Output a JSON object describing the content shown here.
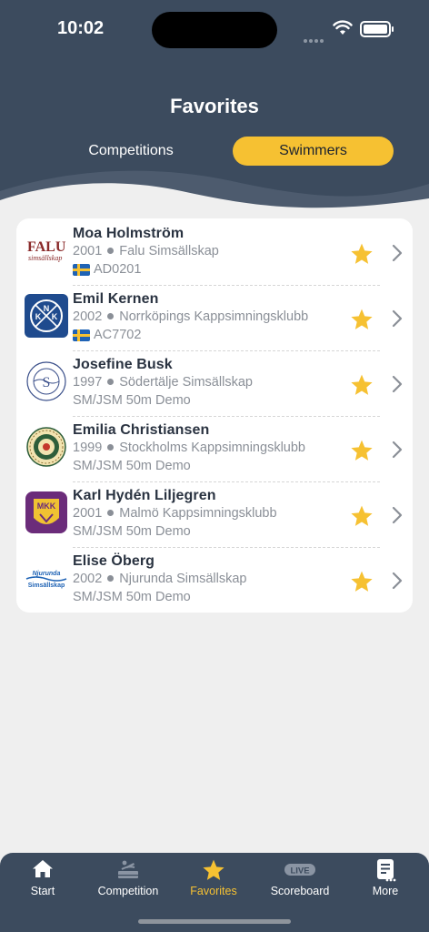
{
  "status": {
    "time": "10:02"
  },
  "header": {
    "title": "Favorites",
    "tabs": [
      {
        "label": "Competitions",
        "selected": false
      },
      {
        "label": "Swimmers",
        "selected": true
      }
    ]
  },
  "swimmers": [
    {
      "name": "Moa Holmström",
      "year": "2001",
      "club": "Falu Simsällskap",
      "line3": "AD0201",
      "flag": "sweden-flag",
      "logo": "falu-logo",
      "logo_text": "FALU",
      "logo_text2": "simsällskap",
      "favorite": true
    },
    {
      "name": "Emil Kernen",
      "year": "2002",
      "club": "Norrköpings Kappsimningsklubb",
      "line3": "AC7702",
      "flag": "sweden-flag",
      "logo": "nkk-logo",
      "logo_text": "NKK",
      "favorite": true
    },
    {
      "name": "Josefine Busk",
      "year": "1997",
      "club": "Södertälje Simsällskap",
      "line3": "SM/JSM 50m Demo",
      "flag": null,
      "logo": "sodertalje-logo",
      "logo_text": "S",
      "favorite": true
    },
    {
      "name": "Emilia Christiansen",
      "year": "1999",
      "club": "Stockholms Kappsimningsklubb",
      "line3": "SM/JSM 50m Demo",
      "flag": null,
      "logo": "stockholm-logo",
      "favorite": true
    },
    {
      "name": "Karl Hydén Liljegren",
      "year": "2001",
      "club": "Malmö Kappsimningsklubb",
      "line3": "SM/JSM 50m Demo",
      "flag": null,
      "logo": "mkk-logo",
      "logo_text": "MKK",
      "favorite": true
    },
    {
      "name": "Elise Öberg",
      "year": "2002",
      "club": "Njurunda Simsällskap",
      "line3": "SM/JSM 50m Demo",
      "flag": null,
      "logo": "njurunda-logo",
      "logo_text": "Njurunda",
      "logo_text2": "Simsällskap",
      "favorite": true
    }
  ],
  "tabbar": [
    {
      "label": "Start",
      "icon": "home-icon",
      "active": false
    },
    {
      "label": "Competition",
      "icon": "competition-icon",
      "active": false
    },
    {
      "label": "Favorites",
      "icon": "star-icon",
      "active": true
    },
    {
      "label": "Scoreboard",
      "icon": "live-icon",
      "icon_text": "LIVE",
      "active": false
    },
    {
      "label": "More",
      "icon": "more-icon",
      "active": false
    }
  ],
  "colors": {
    "header": "#3c4b5e",
    "accent": "#f6c132",
    "background": "#efefef"
  }
}
